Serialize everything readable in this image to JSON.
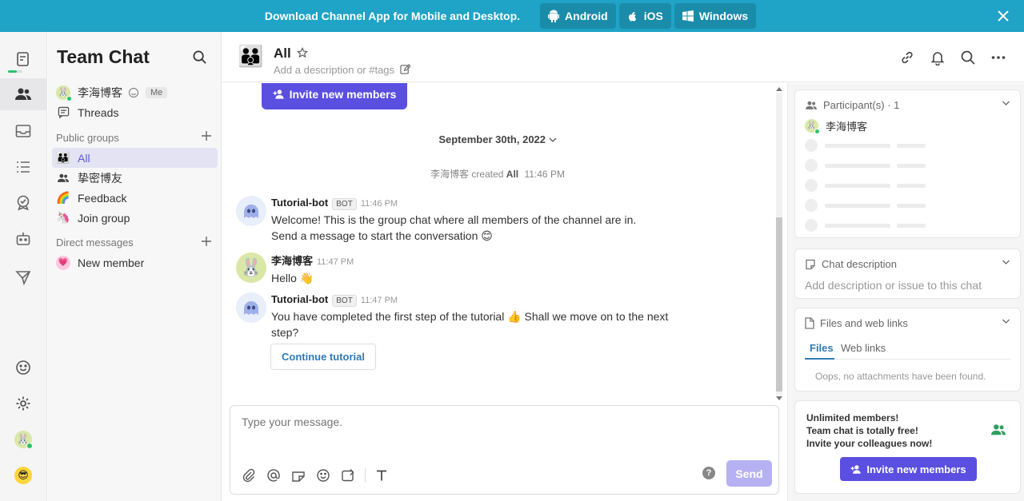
{
  "banner": {
    "text": "Download Channel App for Mobile and Desktop.",
    "buttons": [
      "Android",
      "iOS",
      "Windows"
    ]
  },
  "sidebar": {
    "title": "Team Chat",
    "me": {
      "name": "李海博客",
      "badge": "Me"
    },
    "threads_label": "Threads",
    "public_groups_label": "Public groups",
    "groups": [
      {
        "label": "All",
        "icon": "group-emoji"
      },
      {
        "label": "挚密博友",
        "icon": "people-icon"
      },
      {
        "label": "Feedback",
        "icon": "rainbow-emoji"
      },
      {
        "label": "Join group",
        "icon": "unicorn-emoji"
      }
    ],
    "direct_messages_label": "Direct messages",
    "dms": [
      {
        "label": "New member"
      }
    ]
  },
  "header": {
    "title": "All",
    "description_placeholder": "Add a description or #tags"
  },
  "chat": {
    "invite_label": "Invite new members",
    "date_label": "September 30th, 2022",
    "system_message": {
      "user": "李海博客",
      "action": "created",
      "target": "All",
      "time": "11:46 PM"
    },
    "messages": [
      {
        "name": "Tutorial-bot",
        "badge": "BOT",
        "time": "11:46 PM",
        "lines": [
          "Welcome! This is the group chat where all members of the channel are in.",
          "Send a message to start the conversation 😊"
        ]
      },
      {
        "name": "李海博客",
        "badge": "",
        "time": "11:47 PM",
        "lines": [
          "Hello 👋"
        ]
      },
      {
        "name": "Tutorial-bot",
        "badge": "BOT",
        "time": "11:47 PM",
        "lines": [
          "You have completed the first step of the tutorial 👍 Shall we move on to the next",
          "step?"
        ]
      }
    ],
    "continue_label": "Continue tutorial"
  },
  "composer": {
    "placeholder": "Type your message.",
    "help": "?",
    "send_label": "Send"
  },
  "right_panel": {
    "participants_label": "Participant(s) · 1",
    "participant_name": "李海博客",
    "chat_description_label": "Chat description",
    "chat_description_placeholder": "Add description or issue to this chat",
    "files_label": "Files and web links",
    "tabs": [
      "Files",
      "Web links"
    ],
    "empty_files": "Oops, no attachments have been found.",
    "promo_lines": [
      "Unlimited members!",
      "Team chat is totally free!",
      "Invite your colleagues now!"
    ],
    "promo_button": "Invite new members"
  },
  "colors": {
    "banner": "#1fa3c6",
    "accent": "#5a4fe0",
    "link": "#2d7ab8",
    "online": "#2cc36b"
  }
}
